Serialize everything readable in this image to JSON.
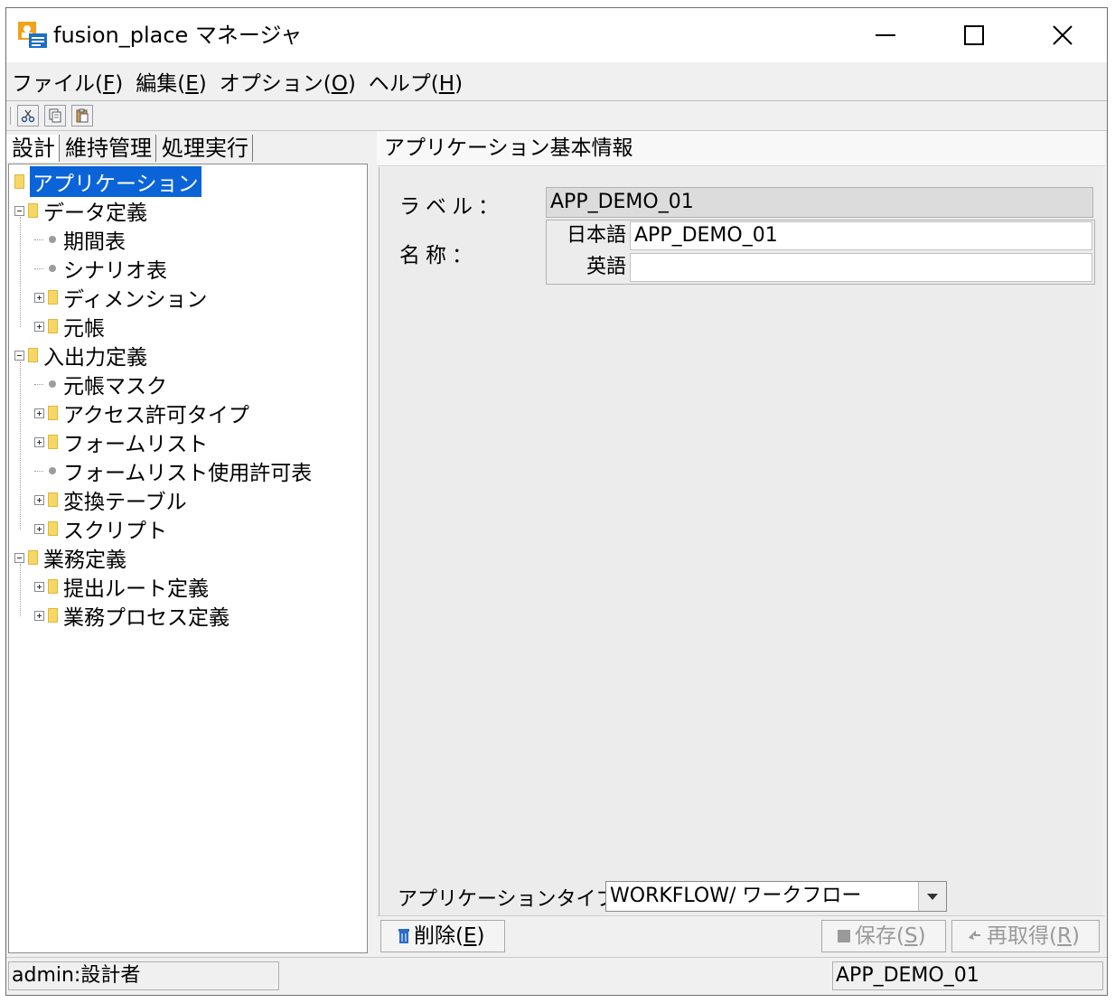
{
  "window": {
    "title": "fusion_place マネージャ",
    "controls": [
      "minimize",
      "maximize",
      "close"
    ]
  },
  "menu": [
    {
      "label": "ファイル(",
      "mnemonic": "F",
      "suffix": ")"
    },
    {
      "label": "編集(",
      "mnemonic": "E",
      "suffix": ")"
    },
    {
      "label": "オプション(",
      "mnemonic": "O",
      "suffix": ")"
    },
    {
      "label": "ヘルプ(",
      "mnemonic": "H",
      "suffix": ")"
    }
  ],
  "toolbar": {
    "icons": [
      "cut-icon",
      "copy-icon",
      "paste-icon"
    ]
  },
  "tabs": [
    {
      "label": "設計",
      "active": true
    },
    {
      "label": "維持管理",
      "active": false
    },
    {
      "label": "処理実行",
      "active": false
    }
  ],
  "tree": [
    {
      "label": "アプリケーション",
      "level": 0,
      "kind": "folder",
      "expander": "none",
      "selected": true
    },
    {
      "label": "データ定義",
      "level": 0,
      "kind": "folder",
      "expander": "minus"
    },
    {
      "label": "期間表",
      "level": 1,
      "kind": "leaf"
    },
    {
      "label": "シナリオ表",
      "level": 1,
      "kind": "leaf"
    },
    {
      "label": "ディメンション",
      "level": 1,
      "kind": "folder",
      "expander": "plus"
    },
    {
      "label": "元帳",
      "level": 1,
      "kind": "folder",
      "expander": "plus"
    },
    {
      "label": "入出力定義",
      "level": 0,
      "kind": "folder",
      "expander": "minus"
    },
    {
      "label": "元帳マスク",
      "level": 1,
      "kind": "leaf"
    },
    {
      "label": "アクセス許可タイプ",
      "level": 1,
      "kind": "folder",
      "expander": "plus"
    },
    {
      "label": "フォームリスト",
      "level": 1,
      "kind": "folder",
      "expander": "plus"
    },
    {
      "label": "フォームリスト使用許可表",
      "level": 1,
      "kind": "leaf"
    },
    {
      "label": "変換テーブル",
      "level": 1,
      "kind": "folder",
      "expander": "plus"
    },
    {
      "label": "スクリプト",
      "level": 1,
      "kind": "folder",
      "expander": "plus"
    },
    {
      "label": "業務定義",
      "level": 0,
      "kind": "folder",
      "expander": "minus"
    },
    {
      "label": "提出ルート定義",
      "level": 1,
      "kind": "folder",
      "expander": "plus"
    },
    {
      "label": "業務プロセス定義",
      "level": 1,
      "kind": "folder",
      "expander": "plus"
    }
  ],
  "detail": {
    "header": "アプリケーション基本情報",
    "label_caption": "ラベル：",
    "label_value": "APP_DEMO_01",
    "name_caption": "名称：",
    "name_ja_caption": "日本語",
    "name_ja_value": "APP_DEMO_01",
    "name_en_caption": "英語",
    "name_en_value": "",
    "type_caption": "アプリケーションタイプ：",
    "type_value": "WORKFLOW/ ワークフロー"
  },
  "buttons": {
    "delete": {
      "label": "削除(",
      "mnemonic": "E",
      "suffix": ")",
      "enabled": true
    },
    "save": {
      "label": "保存(",
      "mnemonic": "S",
      "suffix": ")",
      "enabled": false
    },
    "refresh": {
      "label": "再取得(",
      "mnemonic": "R",
      "suffix": ")",
      "enabled": false
    }
  },
  "status": {
    "user": "admin:設計者",
    "application": "APP_DEMO_01"
  }
}
